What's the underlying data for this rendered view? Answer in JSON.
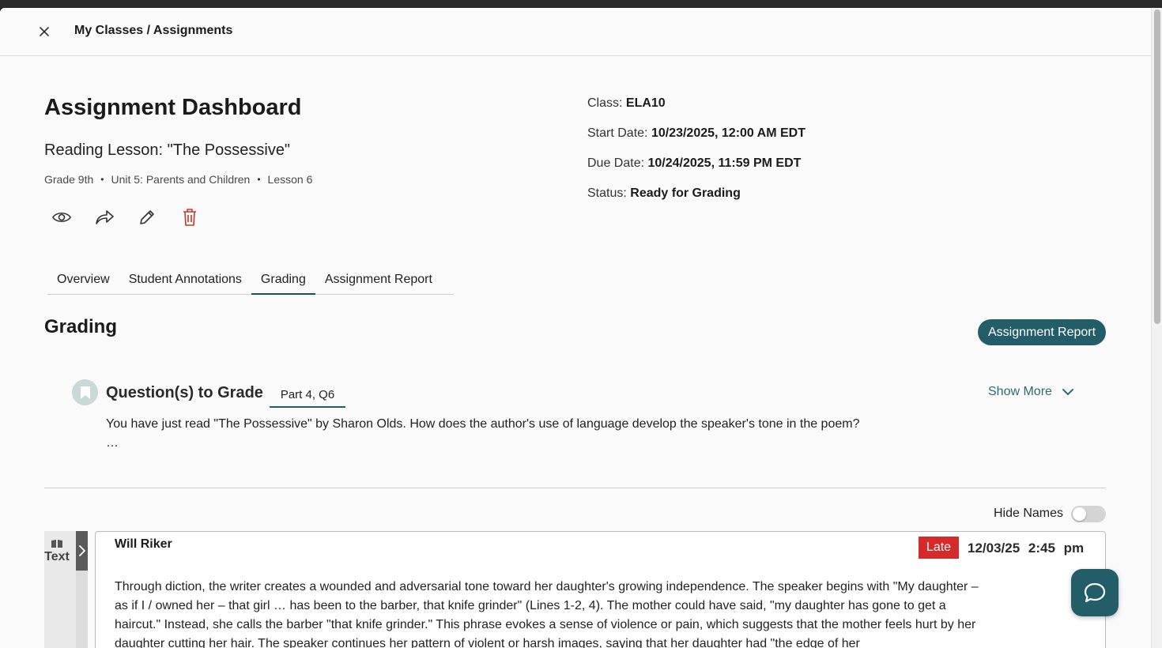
{
  "header": {
    "breadcrumb": "My Classes / Assignments"
  },
  "assignment": {
    "title": "Assignment Dashboard",
    "lesson_title": "Reading Lesson: \"The Possessive\"",
    "grade": "Grade 9th",
    "unit": "Unit 5: Parents and Children",
    "lesson": "Lesson 6",
    "separator": "•"
  },
  "info": {
    "class_label": "Class:",
    "class_value": "ELA10",
    "start_label": "Start Date:",
    "start_value": "10/23/2025, 12:00 AM EDT",
    "due_label": "Due Date:",
    "due_value": "10/24/2025, 11:59 PM EDT",
    "status_label": "Status:",
    "status_value": "Ready for Grading"
  },
  "actions": [
    "eye-icon",
    "share-icon",
    "pencil-icon",
    "trash-icon"
  ],
  "tabs": [
    {
      "label": "Overview"
    },
    {
      "label": "Student Annotations"
    },
    {
      "label": "Grading"
    },
    {
      "label": "Assignment Report"
    }
  ],
  "active_tab": "Grading",
  "grading": {
    "heading": "Grading",
    "report_button": "Assignment Report",
    "question_heading": "Question(s) to Grade",
    "question_part": "Part 4, Q6",
    "show_more": "Show More",
    "question_text": "You have just read \"The Possessive\" by Sharon Olds. How does the author's use of language develop the speaker's tone in the poem?",
    "question_ellipsis": "…",
    "hide_names_label": "Hide Names",
    "hide_names_on": false
  },
  "text_panel": {
    "label": "Text"
  },
  "response": {
    "student": "Will Riker",
    "badge": "Late",
    "submitted": "12/03/25 2:45 pm",
    "text": "Through diction, the writer creates a wounded and adversarial tone toward her daughter's growing independence. The speaker begins with \"My daughter – as if I / owned her – that girl … has been to the barber, that knife grinder\" (Lines 1-2, 4). The mother could have  said, \"my daughter has gone to get a haircut.\" Instead, she calls the barber \"that knife grinder.\" This phrase evokes a sense of violence or pain, which suggests that the mother feels hurt  by her daughter cutting her hair.  The speaker continues her pattern of violent or harsh images, saying that her daughter had \"the edge of her"
  },
  "colors": {
    "accent": "#235e68",
    "late": "#d42a2a",
    "delete": "#c0392b"
  }
}
